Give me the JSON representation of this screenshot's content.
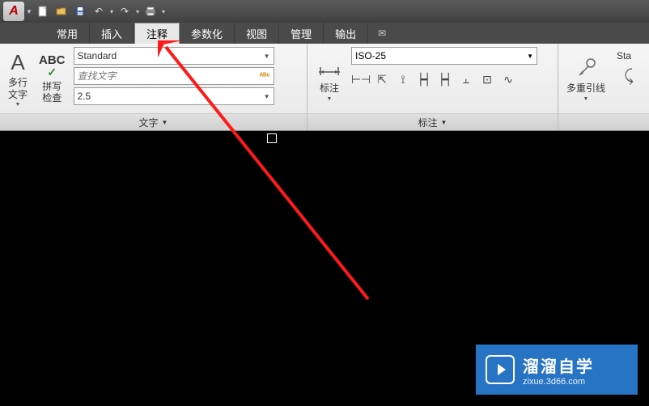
{
  "qat": {
    "icons": [
      "new",
      "open",
      "save",
      "undo",
      "redo",
      "print"
    ]
  },
  "tabs": {
    "items": [
      {
        "label": "常用"
      },
      {
        "label": "插入"
      },
      {
        "label": "注释"
      },
      {
        "label": "参数化"
      },
      {
        "label": "视图"
      },
      {
        "label": "管理"
      },
      {
        "label": "输出"
      }
    ],
    "active_index": 2
  },
  "text_panel": {
    "multiline_label": "多行\n文字",
    "spellcheck_top": "ABC",
    "spellcheck_label": "拼写\n检查",
    "style_value": "Standard",
    "search_placeholder": "查找文字",
    "height_value": "2.5",
    "title": "文字"
  },
  "dim_panel": {
    "dim_label": "标注",
    "style_value": "ISO-25",
    "title": "标注"
  },
  "leader_panel": {
    "label": "多重引线",
    "standard_cut": "Sta"
  },
  "watermark": {
    "title": "溜溜自学",
    "sub": "zixue.3d66.com"
  }
}
